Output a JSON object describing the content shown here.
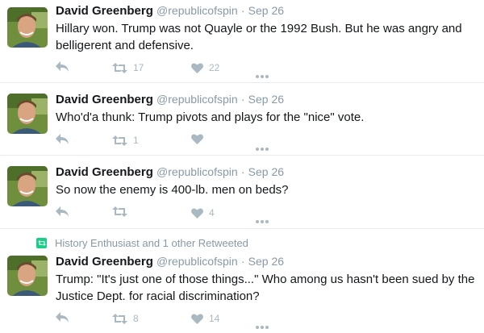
{
  "colors": {
    "name": "#14171a",
    "meta": "#8899a6",
    "icon": "#aab8c2",
    "retweet_green": "#19cf86",
    "divider": "#e6ecf0"
  },
  "tweets": [
    {
      "context": "",
      "author_name": "David Greenberg",
      "author_handle": "@republicofspin",
      "separator": "·",
      "time": "Sep 26",
      "lines": [
        "Hillary won. Trump was not Quayle or the 1992 Bush. But he was angry and",
        "belligerent and defensive."
      ],
      "retweets": "17",
      "likes": "22"
    },
    {
      "context": "",
      "author_name": "David Greenberg",
      "author_handle": "@republicofspin",
      "separator": "·",
      "time": "Sep 26",
      "lines": [
        "Who'd'a thunk: Trump pivots and plays for the \"nice\" vote."
      ],
      "retweets": "1",
      "likes": ""
    },
    {
      "context": "",
      "author_name": "David Greenberg",
      "author_handle": "@republicofspin",
      "separator": "·",
      "time": "Sep 26",
      "lines": [
        "So now the enemy is 400-lb. men on beds?"
      ],
      "retweets": "",
      "likes": "4"
    },
    {
      "context": "History Enthusiast and 1 other Retweeted",
      "author_name": "David Greenberg",
      "author_handle": "@republicofspin",
      "separator": "·",
      "time": "Sep 26",
      "lines": [
        "Trump: \"It's just one of those things...\" Who among us hasn't been sued by the",
        "Justice Dept. for racial discrimination?"
      ],
      "retweets": "8",
      "likes": "14"
    }
  ]
}
